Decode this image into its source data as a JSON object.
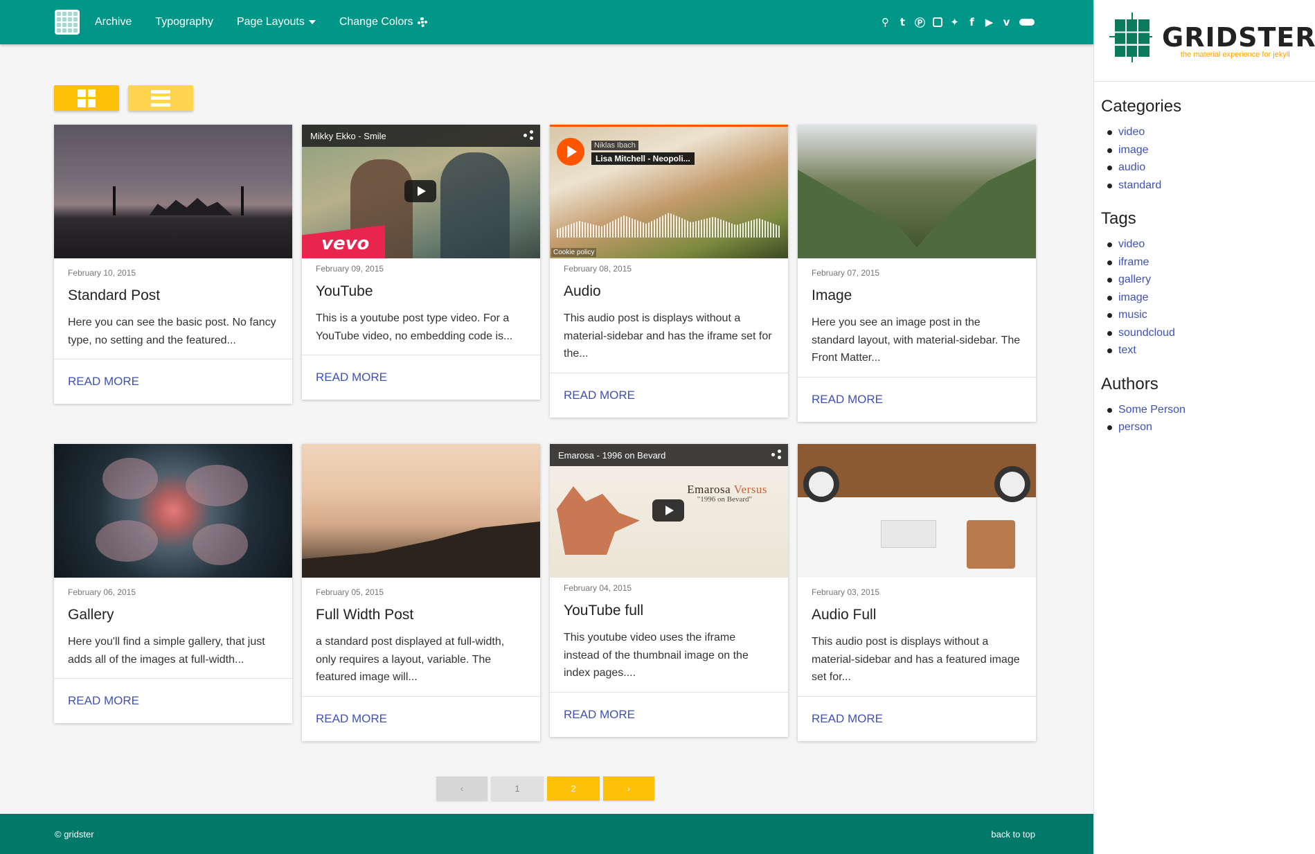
{
  "nav": {
    "links": [
      {
        "label": "Archive"
      },
      {
        "label": "Typography"
      },
      {
        "label": "Page Layouts"
      },
      {
        "label": "Change Colors"
      }
    ],
    "social_icons": [
      "search-icon",
      "tumblr-icon",
      "pinterest-icon",
      "instagram-icon",
      "twitter-icon",
      "facebook-icon",
      "youtube-icon",
      "vimeo-icon",
      "soundcloud-icon"
    ]
  },
  "brand": {
    "name": "GRIDSTER",
    "tagline": "the material experience for jekyll"
  },
  "sidebar": {
    "categories_title": "Categories",
    "categories": [
      "video",
      "image",
      "audio",
      "standard"
    ],
    "tags_title": "Tags",
    "tags": [
      "video",
      "iframe",
      "gallery",
      "image",
      "music",
      "soundcloud",
      "text"
    ],
    "authors_title": "Authors",
    "authors": [
      "Some Person",
      "person"
    ]
  },
  "cards": [
    {
      "date": "February 10, 2015",
      "title": "Standard Post",
      "excerpt": "Here you can see the basic post. No fancy type, no setting and the featured...",
      "action": "READ MORE"
    },
    {
      "date": "February 09, 2015",
      "title": "YouTube",
      "excerpt": "This is a youtube post type video. For a YouTube video, no embedding code is...",
      "action": "READ MORE",
      "video_title": "Mikky Ekko - Smile",
      "brand_text": "vevo"
    },
    {
      "date": "February 08, 2015",
      "title": "Audio",
      "excerpt": "This audio post is displays without a material-sidebar and has the iframe set for the...",
      "action": "READ MORE",
      "sc_user": "Niklas Ibach",
      "sc_track": "Lisa Mitchell - Neopoli...",
      "sc_cookie": "Cookie policy"
    },
    {
      "date": "February 07, 2015",
      "title": "Image",
      "excerpt": "Here you see an image post in the standard layout, with material-sidebar. The Front Matter...",
      "action": "READ MORE"
    },
    {
      "date": "February 06, 2015",
      "title": "Gallery",
      "excerpt": "Here you'll find a simple gallery, that just adds all of the images at full-width...",
      "action": "READ MORE"
    },
    {
      "date": "February 05, 2015",
      "title": "Full Width Post",
      "excerpt": "a standard post displayed at full-width, only requires a layout, variable. The featured image will...",
      "action": "READ MORE"
    },
    {
      "date": "February 04, 2015",
      "title": "YouTube full",
      "excerpt": "This youtube video uses the iframe instead of the thumbnail image on the index pages....",
      "action": "READ MORE",
      "video_title": "Emarosa - 1996 on Bevard",
      "art_title_a": "Emarosa",
      "art_title_b": "Versus",
      "art_sub": "\"1996 on Bevard\""
    },
    {
      "date": "February 03, 2015",
      "title": "Audio Full",
      "excerpt": "This audio post is displays without a material-sidebar and has a featured image set for...",
      "action": "READ MORE"
    }
  ],
  "pagination": {
    "prev": "‹",
    "pages": [
      "1",
      "2"
    ],
    "current": "2",
    "next": "›"
  },
  "footer": {
    "copyright": "© gridster",
    "back_to_top": "back to top"
  },
  "colors": {
    "primary": "#009688",
    "footer": "#00796b",
    "accent": "#ffc107",
    "link": "#3f51b5"
  }
}
